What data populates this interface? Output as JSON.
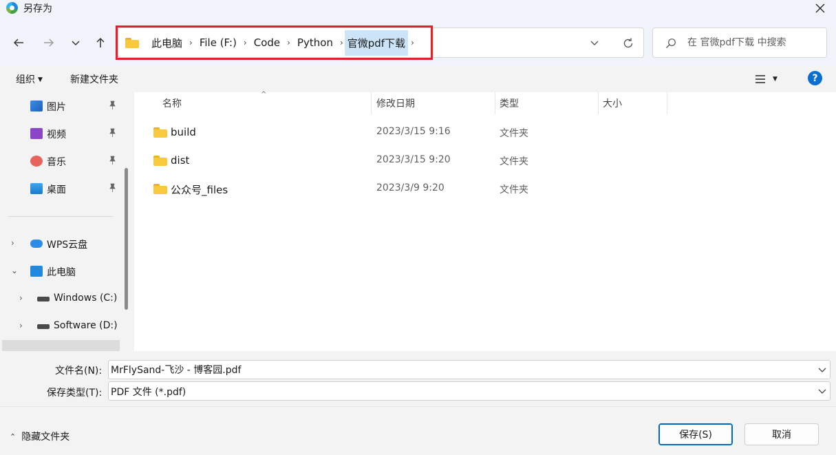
{
  "window": {
    "title": "另存为",
    "close_icon": "close-icon"
  },
  "nav": {
    "back_icon": "arrow-left-icon",
    "forward_icon": "arrow-right-icon",
    "recent_icon": "chevron-down-icon",
    "up_icon": "arrow-up-icon"
  },
  "address": {
    "crumbs": [
      "此电脑",
      "File (F:)",
      "Code",
      "Python",
      "官微pdf下载"
    ],
    "highlight_color": "#e5202a"
  },
  "search": {
    "placeholder": "在 官微pdf下载 中搜索"
  },
  "toolbar": {
    "organize_label": "组织",
    "new_folder_label": "新建文件夹",
    "help_label": "?"
  },
  "sidebar": {
    "quick": [
      {
        "label": "图片",
        "icon": "pictures-icon"
      },
      {
        "label": "视频",
        "icon": "videos-icon"
      },
      {
        "label": "音乐",
        "icon": "music-icon"
      },
      {
        "label": "桌面",
        "icon": "desktop-icon"
      }
    ],
    "tree": [
      {
        "label": "WPS云盘",
        "icon": "cloud-icon"
      },
      {
        "label": "此电脑",
        "icon": "computer-icon"
      },
      {
        "label": "Windows (C:)",
        "icon": "drive-icon"
      },
      {
        "label": "Software (D:)",
        "icon": "drive-icon"
      }
    ]
  },
  "columns": {
    "name": "名称",
    "date": "修改日期",
    "type": "类型",
    "size": "大小"
  },
  "files": [
    {
      "name": "build",
      "date": "2023/3/15 9:16",
      "type": "文件夹"
    },
    {
      "name": "dist",
      "date": "2023/3/15 9:20",
      "type": "文件夹"
    },
    {
      "name": "公众号_files",
      "date": "2023/3/9 9:20",
      "type": "文件夹"
    }
  ],
  "form": {
    "filename_label": "文件名(N):",
    "filename_value": "MrFlySand-飞沙 - 博客园.pdf",
    "filetype_label": "保存类型(T):",
    "filetype_value": "PDF 文件 (*.pdf)"
  },
  "footer": {
    "hide_folders_label": "隐藏文件夹",
    "save_label": "保存(S)",
    "cancel_label": "取消"
  }
}
